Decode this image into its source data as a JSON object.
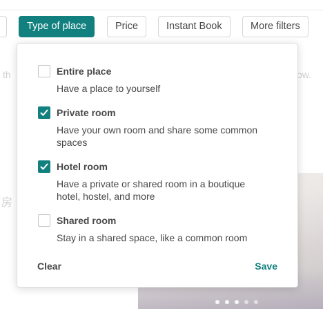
{
  "filters": {
    "type_of_place": "Type of place",
    "price": "Price",
    "instant_book": "Instant Book",
    "more_filters": "More filters"
  },
  "background": {
    "left_fragment": "th",
    "right_fragment": "ow.",
    "cjk_fragment": "房"
  },
  "dropdown": {
    "options": [
      {
        "title": "Entire place",
        "description": "Have a place to yourself",
        "checked": false
      },
      {
        "title": "Private room",
        "description": "Have your own room and share some common spaces",
        "checked": true
      },
      {
        "title": "Hotel room",
        "description": "Have a private or shared room in a boutique hotel, hostel, and more",
        "checked": true
      },
      {
        "title": "Shared room",
        "description": "Stay in a shared space, like a common room",
        "checked": false
      }
    ],
    "clear_label": "Clear",
    "save_label": "Save"
  },
  "colors": {
    "accent": "#12807f",
    "text": "#484848"
  }
}
